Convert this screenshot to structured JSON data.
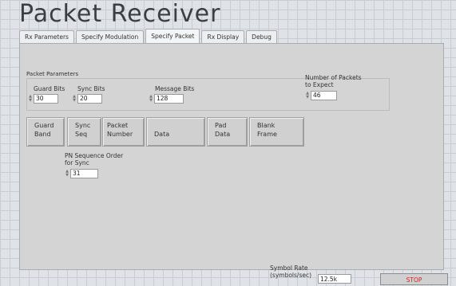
{
  "window": {
    "title": "Packet Receiver"
  },
  "tabs": [
    {
      "label": "Rx Parameters"
    },
    {
      "label": "Specify Modulation"
    },
    {
      "label": "Specify Packet"
    },
    {
      "label": "Rx Display"
    },
    {
      "label": "Debug"
    }
  ],
  "active_tab": "Specify Packet",
  "packet_parameters": {
    "section_label": "Packet Parameters",
    "guard_bits": {
      "label": "Guard Bits",
      "value": "30"
    },
    "sync_bits": {
      "label": "Sync Bits",
      "value": "20"
    },
    "message_bits": {
      "label": "Message Bits",
      "value": "128"
    },
    "num_packets": {
      "label_line1": "Number of Packets",
      "label_line2": "to Expect",
      "value": "46"
    }
  },
  "packet_structure": [
    {
      "line1": "Guard",
      "line2": "Band"
    },
    {
      "line1": "Sync",
      "line2": "Seq"
    },
    {
      "line1": "Packet",
      "line2": "Number"
    },
    {
      "line1": "",
      "line2": "Data"
    },
    {
      "line1": "Pad",
      "line2": "Data"
    },
    {
      "line1": "Blank",
      "line2": "Frame"
    }
  ],
  "pn_sequence": {
    "label_line1": "PN Sequence Order",
    "label_line2": "for Sync",
    "value": "31"
  },
  "symbol_rate": {
    "label_line1": "Symbol Rate",
    "label_line2": "(symbols/sec)",
    "value": "12.5k"
  },
  "stop_button": {
    "label": "STOP",
    "color": "#d42020"
  },
  "icons": {
    "spinner": "increment-decrement-arrows"
  }
}
